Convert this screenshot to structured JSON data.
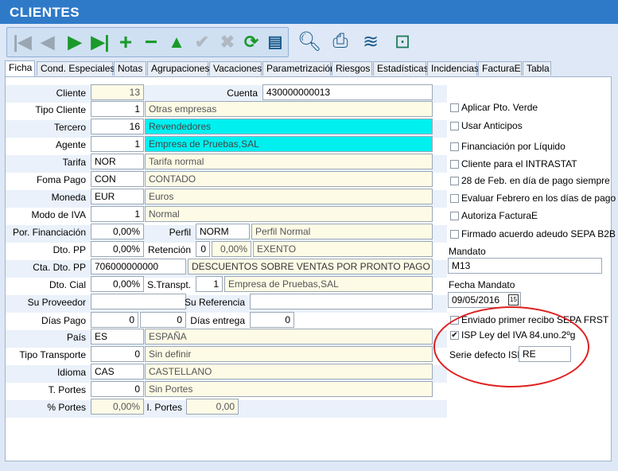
{
  "window": {
    "title": "CLIENTES"
  },
  "toolbar": {
    "icons": [
      "first-icon",
      "prev-icon",
      "next-icon",
      "last-icon",
      "add-icon",
      "delete-icon",
      "up-icon",
      "confirm-icon",
      "cancel-icon",
      "refresh-icon",
      "list-icon",
      "search-icon",
      "print-icon",
      "network-icon",
      "exit-icon"
    ]
  },
  "tabs": [
    "Ficha",
    "Cond. Especiales",
    "Notas",
    "Agrupaciones",
    "Vacaciones",
    "Parametrización",
    "Riesgos",
    "Estadísticas",
    "Incidencias",
    "FacturaE",
    "Tabla"
  ],
  "form": {
    "cliente": {
      "label": "Cliente",
      "value": "13"
    },
    "cuenta": {
      "label": "Cuenta",
      "value": "430000000013"
    },
    "tipo_cliente": {
      "label": "Tipo Cliente",
      "code": "1",
      "desc": "Otras empresas"
    },
    "tercero": {
      "label": "Tercero",
      "code": "16",
      "desc": "Revendedores"
    },
    "agente": {
      "label": "Agente",
      "code": "1",
      "desc": "Empresa de Pruebas,SAL"
    },
    "tarifa": {
      "label": "Tarifa",
      "code": "NOR",
      "desc": "Tarifa normal"
    },
    "forma_pago": {
      "label": "Foma Pago",
      "code": "CON",
      "desc": "CONTADO"
    },
    "moneda": {
      "label": "Moneda",
      "code": "EUR",
      "desc": "Euros"
    },
    "modo_iva": {
      "label": "Modo de IVA",
      "code": "1",
      "desc": "Normal"
    },
    "por_financiacion": {
      "label": "Por. Financiación",
      "value": "0,00%"
    },
    "perfil": {
      "label": "Perfil",
      "code": "NORM",
      "desc": "Perfil Normal"
    },
    "dto_pp": {
      "label": "Dto. PP",
      "value": "0,00%"
    },
    "retencion": {
      "label": "Retención",
      "code": "0",
      "pct": "0,00%",
      "desc": "EXENTO"
    },
    "cta_dto_pp": {
      "label": "Cta. Dto. PP",
      "code": "706000000000",
      "desc": "DESCUENTOS SOBRE VENTAS POR PRONTO PAGO DE MI"
    },
    "dto_cial": {
      "label": "Dto. Cial",
      "value": "0,00%"
    },
    "s_transpt": {
      "label": "S.Transpt.",
      "code": "1",
      "desc": "Empresa de Pruebas,SAL"
    },
    "su_proveedor": {
      "label": "Su Proveedor",
      "value": ""
    },
    "su_referencia": {
      "label": "Su Referencia",
      "value": ""
    },
    "dias_pago": {
      "label": "Días Pago",
      "v1": "0",
      "v2": "0"
    },
    "dias_entrega": {
      "label": "Días entrega",
      "value": "0"
    },
    "pais": {
      "label": "País",
      "code": "ES",
      "desc": "ESPAÑA"
    },
    "tipo_transporte": {
      "label": "Tipo Transporte",
      "code": "0",
      "desc": "Sin definir"
    },
    "idioma": {
      "label": "Idioma",
      "code": "CAS",
      "desc": "CASTELLANO"
    },
    "t_portes": {
      "label": "T. Portes",
      "code": "0",
      "desc": "Sin Portes"
    },
    "pct_portes": {
      "label": "% Portes",
      "value": "0,00%"
    },
    "i_portes": {
      "label": "I. Portes",
      "value": "0,00"
    }
  },
  "options": [
    {
      "label": "Aplicar Pto. Verde",
      "checked": false
    },
    {
      "label": "Usar Anticipos",
      "checked": false
    },
    {
      "label": "Financiación por Líquido",
      "checked": false
    },
    {
      "label": "Cliente para el INTRASTAT",
      "checked": false
    },
    {
      "label": "28 de Feb. en día de pago siempre",
      "checked": false
    },
    {
      "label": "Evaluar Febrero en los días de pago",
      "checked": false
    },
    {
      "label": "Autoriza FacturaE",
      "checked": false
    },
    {
      "label": "Firmado acuerdo adeudo SEPA B2B",
      "checked": false
    }
  ],
  "mandato": {
    "label": "Mandato",
    "value": "M13"
  },
  "fecha_mandato": {
    "label": "Fecha Mandato",
    "value": "09/05/2016",
    "cal": "15"
  },
  "sepa_frst": {
    "label": "Enviado primer recibo SEPA FRST",
    "checked": false
  },
  "isp": {
    "label": "ISP Ley del IVA 84.uno.2ºg",
    "checked": true,
    "check_mark": "✔"
  },
  "serie_isp": {
    "label": "Serie defecto ISP",
    "value": "RE"
  }
}
